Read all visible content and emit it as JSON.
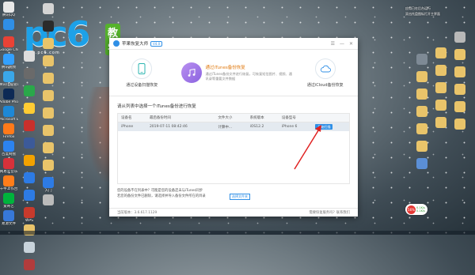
{
  "desktop_left_col1": [
    {
      "label": "腾讯QQ",
      "color": "#e8e8e8"
    },
    {
      "label": "",
      "color": "#2f8fe6"
    },
    {
      "label": "Google Chrome",
      "color": "#e94235"
    },
    {
      "label": "腾讯视频",
      "color": "#33a0ff"
    },
    {
      "label": "腾讯电脑管家",
      "color": "#3aa7e9"
    },
    {
      "label": "Adobe Photoshop",
      "color": "#0d2a55"
    },
    {
      "label": "Microsoft Edge",
      "color": "#1e88d6"
    },
    {
      "label": "Firefox",
      "color": "#ff7a1a"
    },
    {
      "label": "百度网盘",
      "color": "#2c83f0"
    },
    {
      "label": "网易云音乐",
      "color": "#d6313a"
    },
    {
      "label": "千牛工作台",
      "color": "#ff7d1a"
    },
    {
      "label": "爱奇艺",
      "color": "#00b33c"
    },
    {
      "label": "易源文件",
      "color": "#3778d8"
    }
  ],
  "desktop_left_col2": [
    {
      "label": "",
      "color": "#dddddd"
    },
    {
      "label": "",
      "color": "#6a6a6a"
    },
    {
      "label": "",
      "color": "#2aa84a"
    },
    {
      "label": "",
      "color": "#ffcc33"
    },
    {
      "label": "",
      "color": "#c9302c"
    },
    {
      "label": "",
      "color": "#3c5a99"
    },
    {
      "label": "",
      "color": "#f2a200"
    },
    {
      "label": "",
      "color": "#2d7be5"
    },
    {
      "label": "",
      "color": "#2d7be5"
    },
    {
      "label": "WPS",
      "color": "#c73a2c"
    },
    {
      "label": "",
      "color": "#e9c46a"
    },
    {
      "label": "",
      "color": "#c8d3db"
    },
    {
      "label": "",
      "color": "#b23c3c"
    }
  ],
  "desktop_left_col3": [
    {
      "label": "",
      "color": "#d4d4d4"
    },
    {
      "label": "",
      "color": "#2b2b2b"
    },
    {
      "label": "",
      "color": "#e9c46a"
    },
    {
      "label": "",
      "color": "#e9c46a"
    },
    {
      "label": "",
      "color": "#e9c46a"
    },
    {
      "label": "",
      "color": "#e9c46a"
    },
    {
      "label": "",
      "color": "#e9c46a"
    },
    {
      "label": "",
      "color": "#e9c46a"
    },
    {
      "label": "",
      "color": "#e9c46a"
    },
    {
      "label": "",
      "color": "#e9c46a"
    },
    {
      "label": "入门",
      "color": "#2d7be5"
    },
    {
      "label": "",
      "color": "#bbbbbb"
    }
  ],
  "logo": {
    "text": "pc6",
    "cn": "教学",
    "url": "www.pc6.com"
  },
  "window": {
    "title": "苹果恢复大师",
    "version": "V4.0",
    "controls": [
      "☰",
      "—",
      "✕"
    ],
    "modes": [
      {
        "label": "通过设备扫描恢复"
      },
      {
        "title": "通过iTunes备份恢复",
        "desc": "通过iTunes备份文件进行恢复，可恢复短信图片、视频、通讯录等重要文件数据"
      },
      {
        "label": "通过iCloud备份恢复"
      }
    ],
    "subtitle": "请从列表中选择一个iTunes备份进行恢复",
    "table": {
      "headers": [
        "设备名",
        "最后备份时间",
        "文件大小",
        "系统版本",
        "设备型号",
        ""
      ],
      "row": {
        "name": "iPhone",
        "time": "2019-07-11 08:42:46",
        "size": "计算中...",
        "ios": "iOS12.2",
        "model": "iPhone 6",
        "action": "开始扫描"
      }
    },
    "hint_line1": "您的设备不在列表中？可能是您的设备还未与iTunes同步",
    "hint_line2": "若您的备份文件已删除，请选择并导入备份文件所在的目录",
    "hint_link": "选择文件夹",
    "status_left": "当前版本：3.6.617.1129",
    "status_right": "需要恢复服务吗？联系我们"
  },
  "right_panel": {
    "line1": "应用已在后台运行",
    "line2": "双击托盘图标打开主界面"
  },
  "desktop_right_col1": [
    {
      "label": "",
      "color": "#7e8a95"
    },
    {
      "label": "",
      "color": "#e9c46a"
    },
    {
      "label": "",
      "color": "#e9c46a"
    },
    {
      "label": "",
      "color": "#e9c46a"
    },
    {
      "label": "",
      "color": "#e9c46a"
    },
    {
      "label": "",
      "color": "#e9c46a"
    },
    {
      "label": "",
      "color": "#5b8fd6"
    }
  ],
  "desktop_right_col2": [
    {
      "label": "",
      "color": "#e9c46a"
    },
    {
      "label": "",
      "color": "#e9c46a"
    },
    {
      "label": "",
      "color": "#e9c46a"
    },
    {
      "label": "",
      "color": "#e9c46a"
    },
    {
      "label": "",
      "color": "#e9c46a"
    }
  ],
  "desktop_right_col3": [
    {
      "label": "",
      "color": "#b8b8b8"
    },
    {
      "label": "",
      "color": "#e9c46a"
    },
    {
      "label": "",
      "color": "#e9c46a"
    },
    {
      "label": "",
      "color": "#e9c46a"
    },
    {
      "label": "",
      "color": "#e9c46a"
    },
    {
      "label": "",
      "color": "#e9c46a"
    }
  ],
  "net_widget": {
    "percent": "56%",
    "up": "0.1K/s",
    "down": "0.1K/s"
  }
}
